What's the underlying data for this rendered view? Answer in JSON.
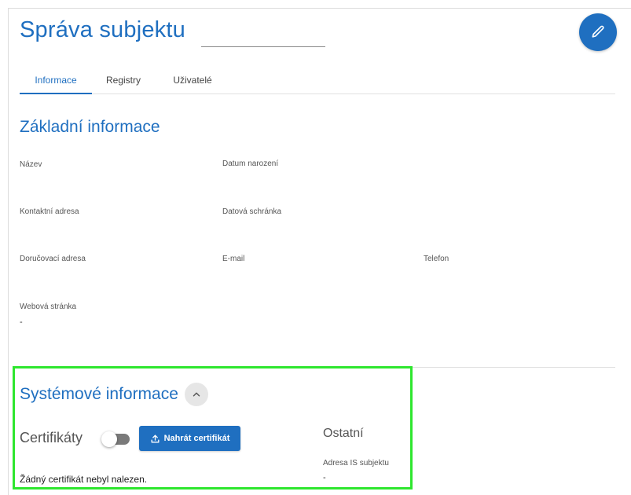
{
  "header": {
    "title": "Správa subjektu",
    "title_input_value": ""
  },
  "tabs": [
    {
      "label": "Informace",
      "active": true
    },
    {
      "label": "Registry",
      "active": false
    },
    {
      "label": "Uživatelé",
      "active": false
    }
  ],
  "basic_info": {
    "title": "Základní informace",
    "fields": {
      "nazev": {
        "label": "Název",
        "value": ""
      },
      "datum_narozeni": {
        "label": "Datum narození",
        "value": ""
      },
      "kontaktni_adresa": {
        "label": "Kontaktní adresa",
        "value": ""
      },
      "datova_schranka": {
        "label": "Datová schránka",
        "value": ""
      },
      "dorucovaci_adresa": {
        "label": "Doručovací adresa",
        "value": ""
      },
      "email": {
        "label": "E-mail",
        "value": ""
      },
      "telefon": {
        "label": "Telefon",
        "value": ""
      },
      "webova_stranka": {
        "label": "Webová stránka",
        "value": "-"
      }
    }
  },
  "system_info": {
    "title": "Systémové informace",
    "certificates": {
      "label": "Certifikáty",
      "toggle_on": false,
      "upload_label": "Nahrát certifikát",
      "empty_message": "Žádný certifikát nebyl nalezen."
    },
    "other": {
      "title": "Ostatní",
      "adresa_is": {
        "label": "Adresa IS subjektu",
        "value": "-"
      }
    }
  },
  "icons": {
    "edit": "pencil-icon",
    "collapse": "chevron-up-icon",
    "upload": "upload-icon"
  },
  "colors": {
    "primary": "#1f6fc0",
    "highlight": "#2ee62e"
  }
}
